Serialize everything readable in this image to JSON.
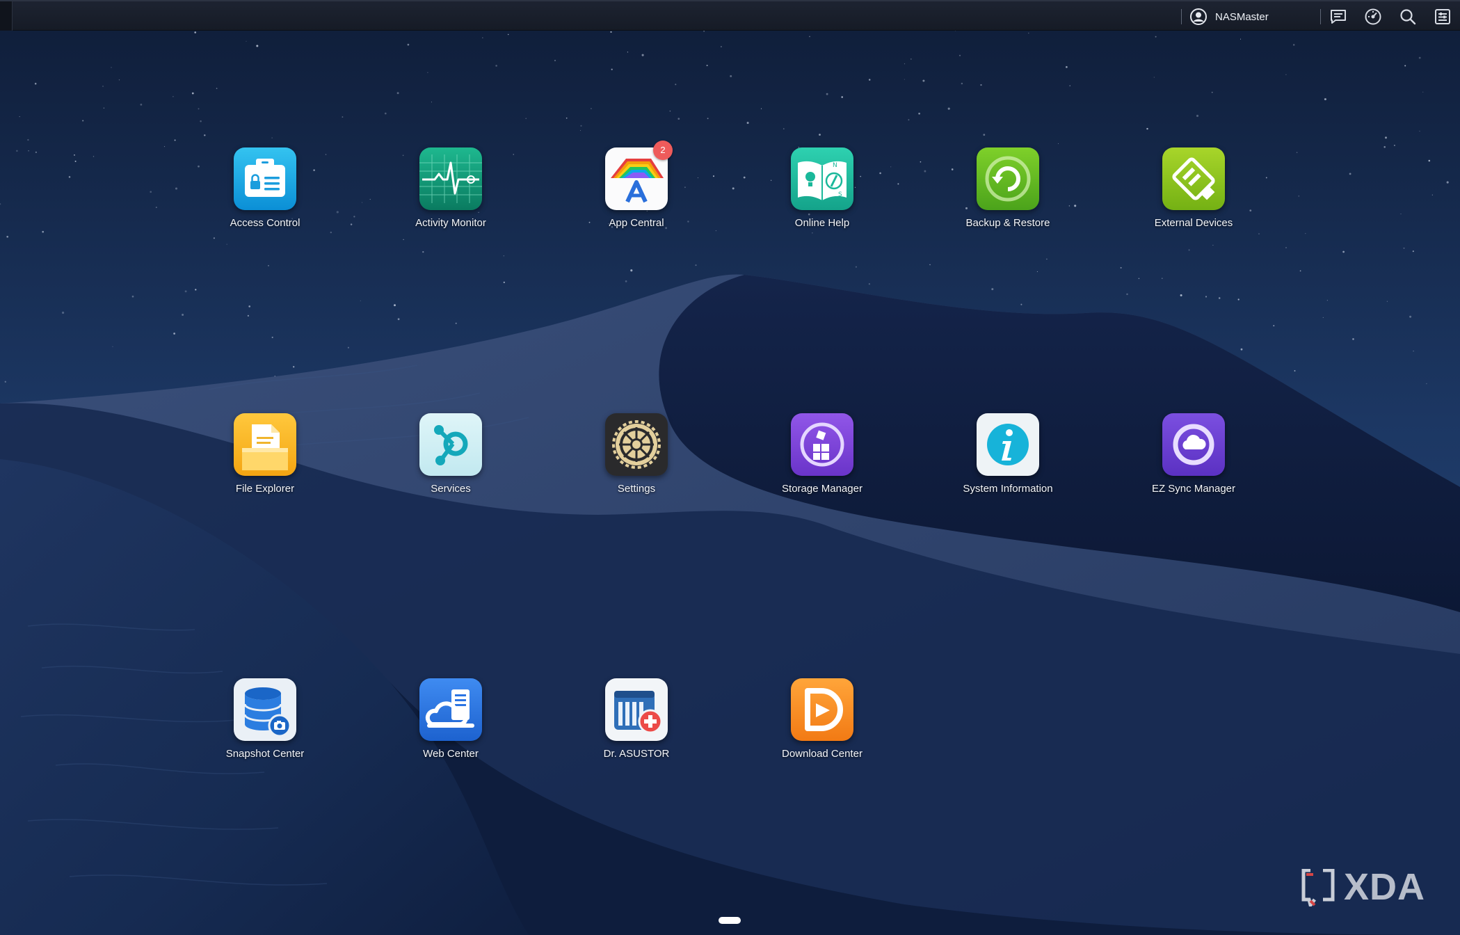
{
  "taskbar": {
    "username": "NASMaster"
  },
  "apps": [
    {
      "label": "Access Control",
      "icon": "access-control-icon"
    },
    {
      "label": "Activity Monitor",
      "icon": "activity-monitor-icon"
    },
    {
      "label": "App Central",
      "icon": "app-central-icon",
      "badge": "2"
    },
    {
      "label": "Online Help",
      "icon": "online-help-icon"
    },
    {
      "label": "Backup & Restore",
      "icon": "backup-restore-icon"
    },
    {
      "label": "External Devices",
      "icon": "external-devices-icon"
    },
    {
      "label": "File Explorer",
      "icon": "file-explorer-icon"
    },
    {
      "label": "Services",
      "icon": "services-icon"
    },
    {
      "label": "Settings",
      "icon": "settings-icon"
    },
    {
      "label": "Storage Manager",
      "icon": "storage-manager-icon"
    },
    {
      "label": "System Information",
      "icon": "system-information-icon"
    },
    {
      "label": "EZ Sync Manager",
      "icon": "ez-sync-manager-icon"
    },
    {
      "label": "Snapshot Center",
      "icon": "snapshot-center-icon"
    },
    {
      "label": "Web Center",
      "icon": "web-center-icon"
    },
    {
      "label": "Dr. ASUSTOR",
      "icon": "dr-asustor-icon"
    },
    {
      "label": "Download Center",
      "icon": "download-center-icon"
    }
  ],
  "watermark": {
    "text": "XDA"
  },
  "colors": {
    "taskbar": "#1a1f2b",
    "sky": "#132544",
    "dune_dark": "#0d1a33",
    "badge": "#ee5b5b"
  }
}
